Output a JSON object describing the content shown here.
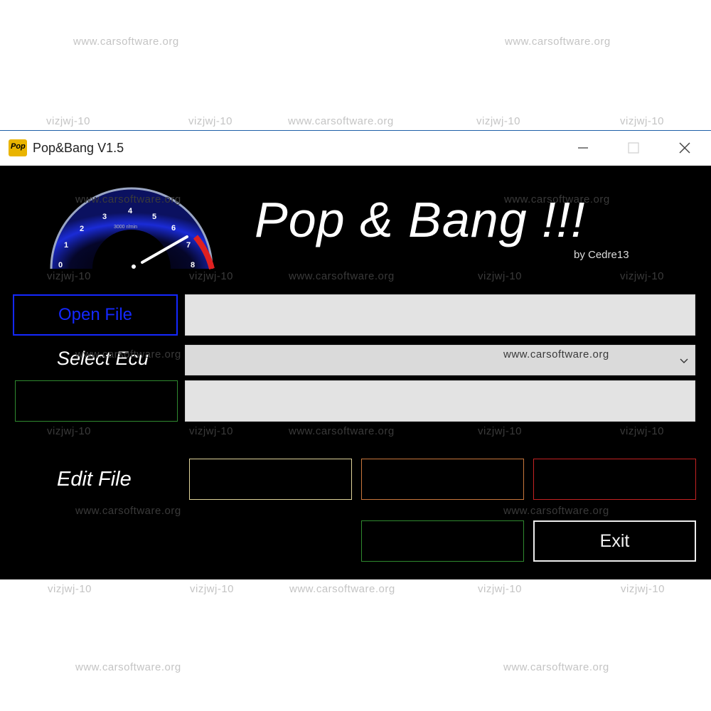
{
  "window": {
    "title": "Pop&Bang  V1.5",
    "icon": "app-icon",
    "controls": {
      "minimize": "minimize-icon",
      "maximize": "maximize-icon",
      "close": "close-icon"
    }
  },
  "banner": {
    "title": "Pop & Bang !!!",
    "byline": "by Cedre13",
    "gauge": {
      "icon": "tachometer-gauge",
      "ticks": [
        "0",
        "1",
        "2",
        "3",
        "4",
        "5",
        "6",
        "7",
        "8"
      ],
      "unit": "3000 r/min"
    }
  },
  "controls": {
    "open_file_label": "Open File",
    "file_path_value": "",
    "select_ecu_label": "Select Ecu",
    "ecu_selected_value": "",
    "ecu_info_value": "",
    "edit_file_label": "Edit File",
    "exit_label": "Exit"
  },
  "colors": {
    "background": "#000000",
    "open_border": "#1428ff",
    "green_border": "#2f8a2f",
    "yellow_border": "#e0d39a",
    "orange_border": "#c9773c",
    "red_border": "#c42222",
    "exit_border": "#ededed",
    "field_bg": "#e3e3e3"
  },
  "watermarks": {
    "site": "www.carsoftware.org",
    "tag": "vizjwj-10"
  }
}
